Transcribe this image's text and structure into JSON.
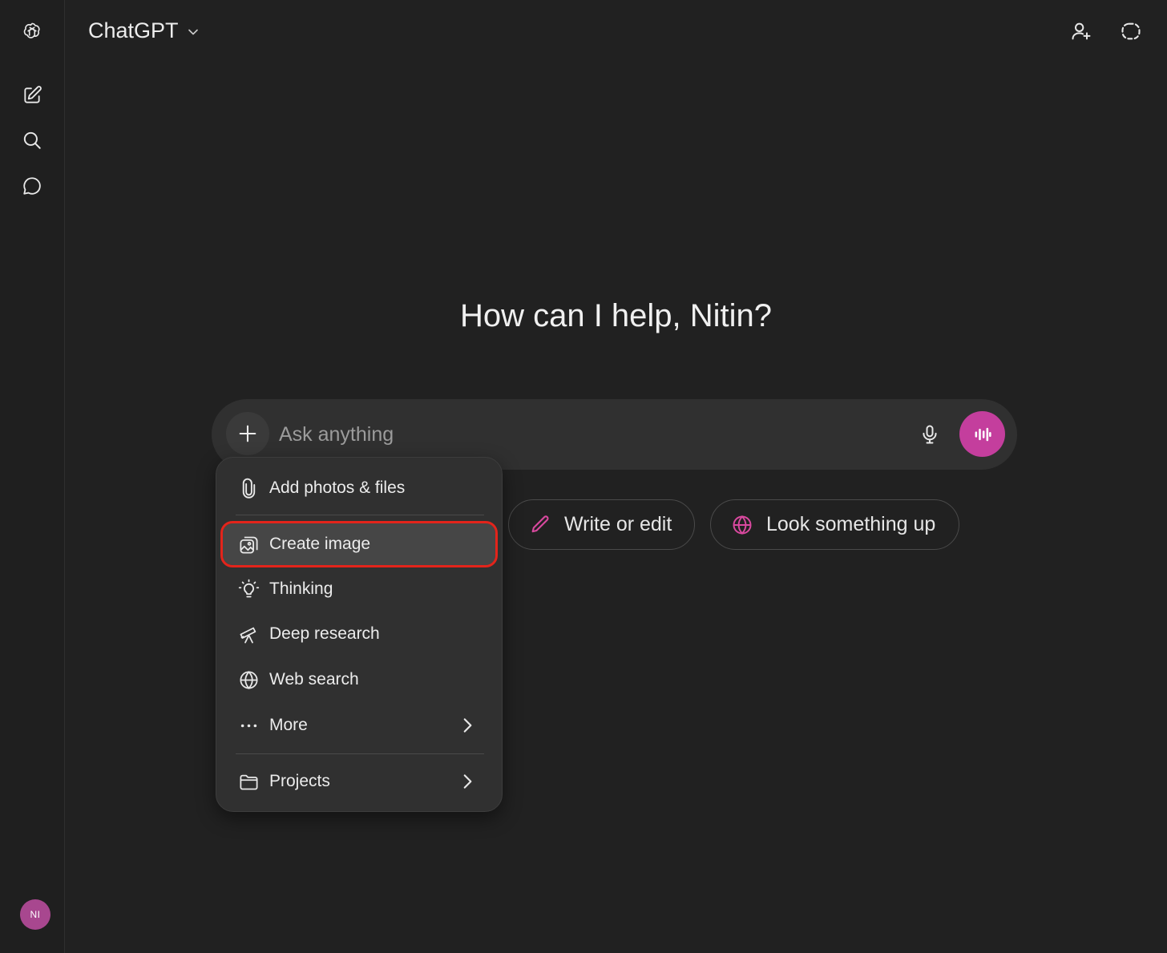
{
  "app": {
    "title": "ChatGPT"
  },
  "user": {
    "initials": "NI"
  },
  "main": {
    "greeting": "How can I help, Nitin?"
  },
  "composer": {
    "placeholder": "Ask anything"
  },
  "suggestions": [
    {
      "label": "Write or edit",
      "icon": "pencil-icon"
    },
    {
      "label": "Look something up",
      "icon": "globe-icon"
    }
  ],
  "menu": {
    "items": [
      {
        "label": "Add photos & files",
        "icon": "paperclip-icon"
      },
      {
        "label": "Create image",
        "icon": "image-icon",
        "highlighted": true
      },
      {
        "label": "Thinking",
        "icon": "lightbulb-icon"
      },
      {
        "label": "Deep research",
        "icon": "telescope-icon"
      },
      {
        "label": "Web search",
        "icon": "globe-icon"
      },
      {
        "label": "More",
        "icon": "dots-icon",
        "submenu": true
      },
      {
        "label": "Projects",
        "icon": "folder-icon",
        "submenu": true
      }
    ]
  },
  "colors": {
    "background": "#212121",
    "accent": "#c43e9d",
    "highlight_outline": "#e3241b",
    "menu_bg": "#303030"
  }
}
